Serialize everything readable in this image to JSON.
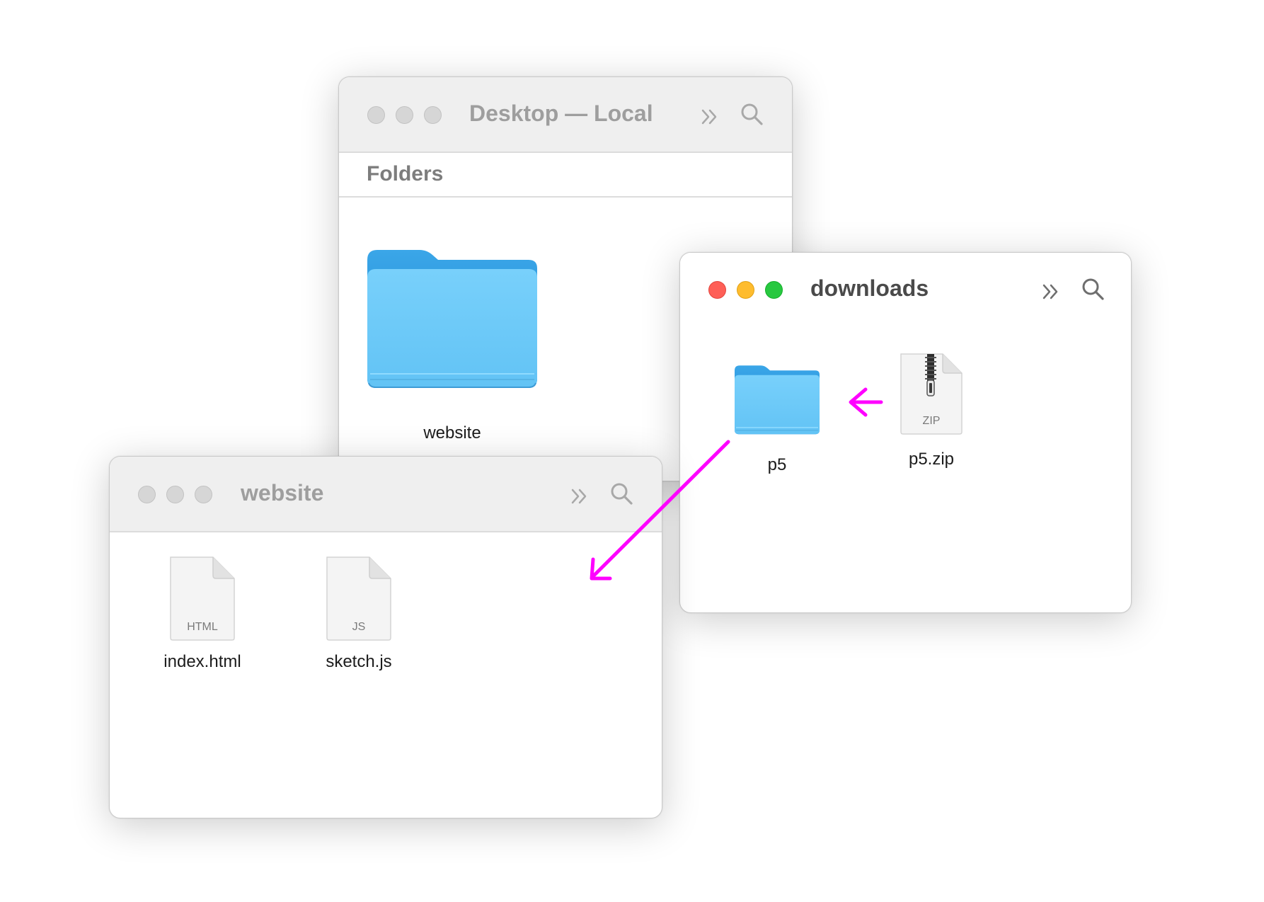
{
  "windows": {
    "desktop": {
      "title": "Desktop — Local",
      "section_title": "Folders",
      "items": [
        {
          "name": "website",
          "kind": "folder"
        }
      ]
    },
    "downloads": {
      "title": "downloads",
      "items": [
        {
          "name": "p5",
          "kind": "folder"
        },
        {
          "name": "p5.zip",
          "kind": "zip",
          "type_label": "ZIP"
        }
      ]
    },
    "website": {
      "title": "website",
      "items": [
        {
          "name": "index.html",
          "kind": "document",
          "type_label": "HTML"
        },
        {
          "name": "sketch.js",
          "kind": "document",
          "type_label": "JS"
        }
      ]
    }
  },
  "colors": {
    "annotation_arrow": "#ff00ff",
    "folder_front": "#6ecbf9",
    "folder_back": "#2c9ae0",
    "light_red": "#fe5f57",
    "light_yellow": "#febc2e",
    "light_green": "#28c840"
  },
  "icons": [
    "chevron-double-right-icon",
    "search-icon",
    "folder-icon",
    "zip-file-icon",
    "document-icon",
    "arrow-icon"
  ]
}
